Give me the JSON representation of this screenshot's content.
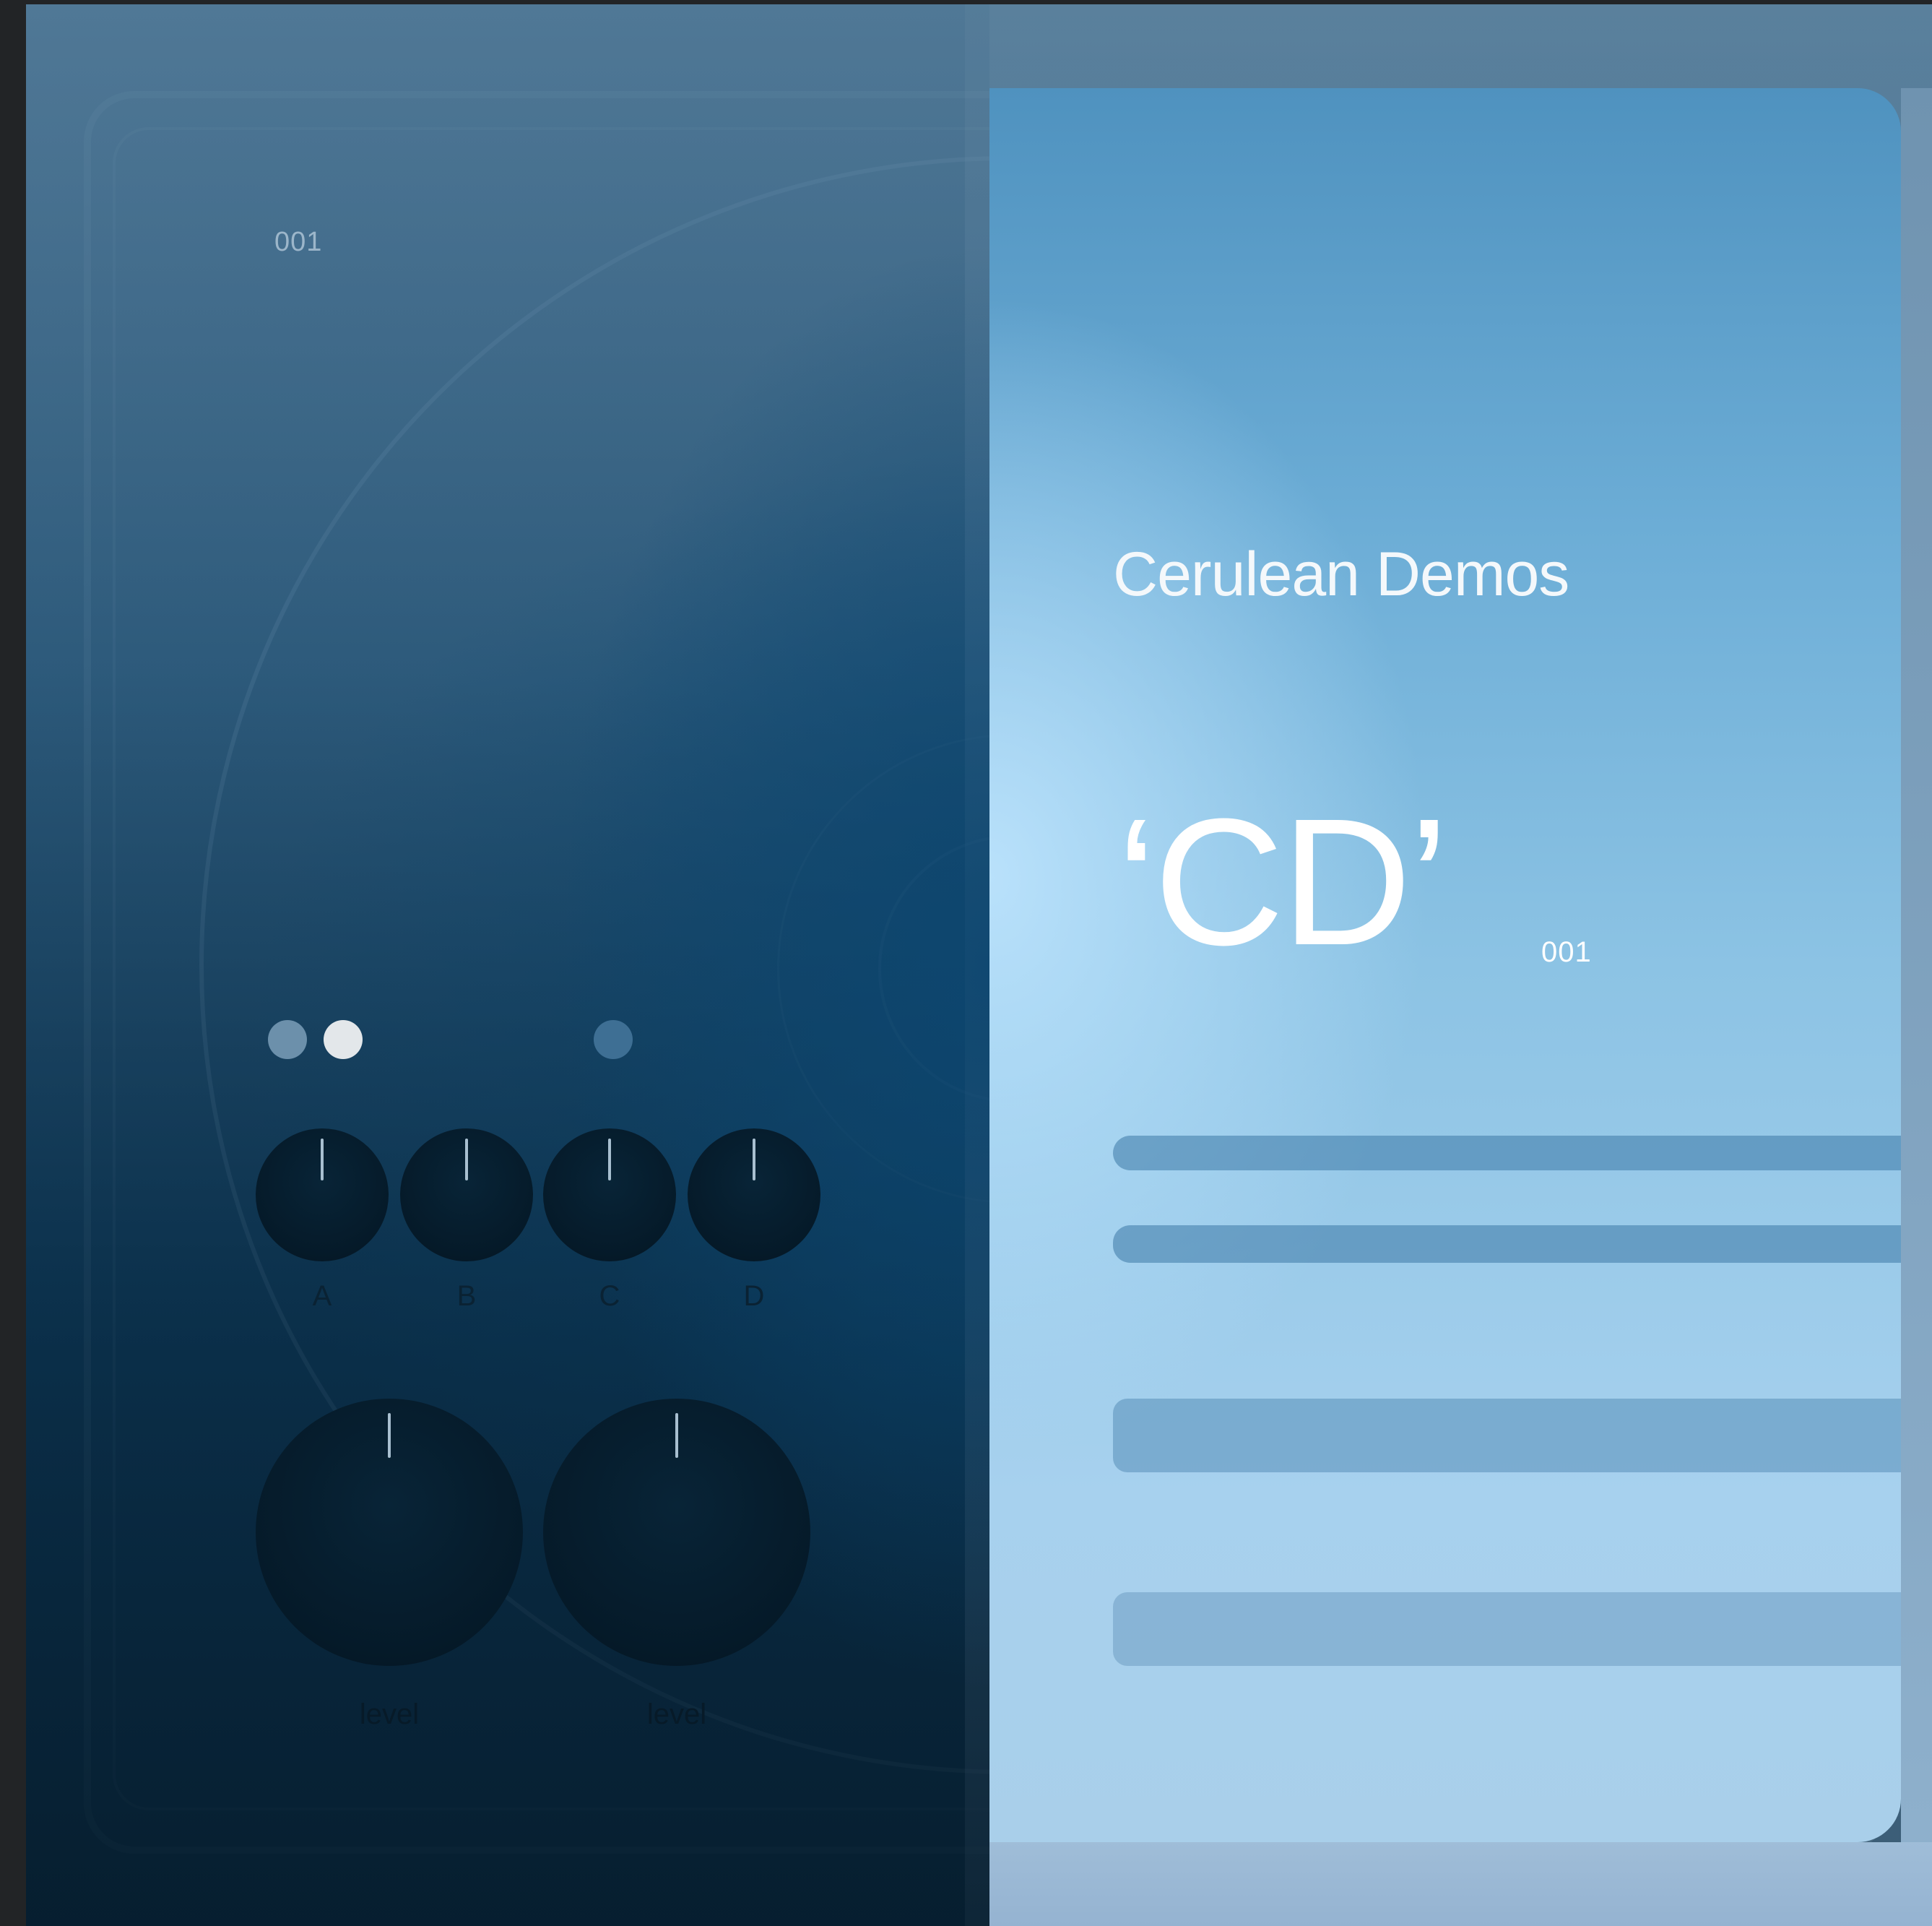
{
  "case": {
    "number_top": "001",
    "title": "Cerulean Demos",
    "big_label": "‘CD’",
    "number_big": "001"
  },
  "controls": {
    "indicators": [
      {
        "name": "indicator-1",
        "state": "dim",
        "color": "#6c90ab"
      },
      {
        "name": "indicator-2",
        "state": "on",
        "color": "#e3e7ea"
      },
      {
        "name": "indicator-3",
        "state": "dim",
        "color": "#3e6f94"
      }
    ],
    "knobs": [
      {
        "label": "A"
      },
      {
        "label": "B"
      },
      {
        "label": "C"
      },
      {
        "label": "D"
      }
    ],
    "level_knobs": [
      {
        "label": "level"
      },
      {
        "label": "level"
      }
    ]
  },
  "colors": {
    "left_panel": "#0b3a5a",
    "right_panel": "#8cc3e4",
    "text_light": "#f4f8fb",
    "knob": "#051a29"
  }
}
